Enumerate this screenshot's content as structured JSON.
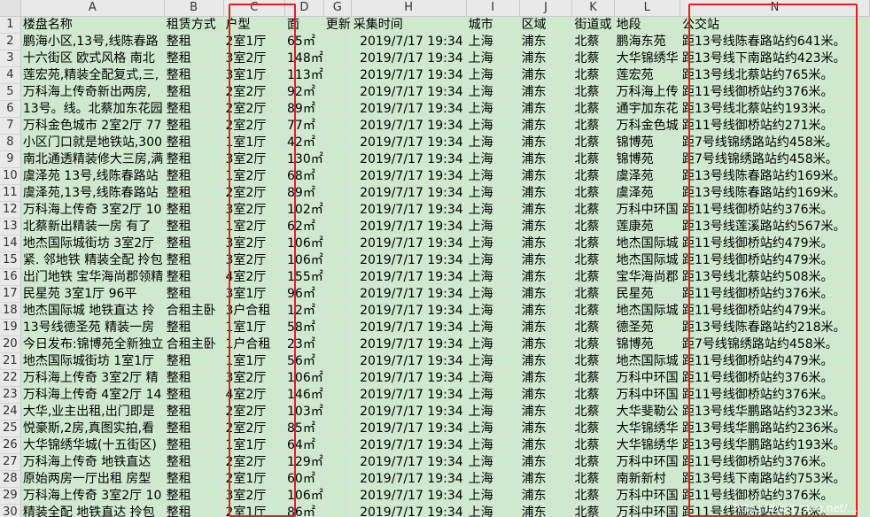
{
  "colhead": [
    "",
    "A",
    "B",
    "C",
    "D",
    "G",
    "H",
    "I",
    "J",
    "K",
    "L",
    "N"
  ],
  "rownums": [
    "1",
    "2",
    "3",
    "4",
    "5",
    "6",
    "7",
    "8",
    "9",
    "10",
    "11",
    "12",
    "13",
    "14",
    "15",
    "16",
    "17",
    "18",
    "19",
    "20",
    "21",
    "22",
    "23",
    "24",
    "25",
    "26",
    "27",
    "28",
    "29",
    "30"
  ],
  "header": [
    "楼盘名称",
    "租赁方式",
    "户型",
    "面",
    "更新",
    "采集时间",
    "城市",
    "区域",
    "街道或",
    "地段",
    "公交站"
  ],
  "rows": [
    [
      "鹏海小区,13号,线陈春路",
      "整租",
      "2室1厅",
      "65㎡",
      "",
      "2019/7/17 19:34",
      "上海",
      "浦东",
      "北蔡",
      "鹏海东苑",
      "距13号线陈春路站约641米。"
    ],
    [
      "十六街区 欧式风格 南北",
      "整租",
      "3室2厅",
      "148㎡",
      "",
      "2019/7/17 19:34",
      "上海",
      "浦东",
      "北蔡",
      "大华锦绣华",
      "距13号线下南路站约423米。"
    ],
    [
      "莲宏苑,精装全配复式,三,",
      "整租",
      "3室1厅",
      "113㎡",
      "",
      "2019/7/17 19:34",
      "上海",
      "浦东",
      "北蔡",
      "莲宏苑",
      "距13号线北蔡站约765米。"
    ],
    [
      "万科海上传奇新出两房,",
      "整租",
      "2室2厅",
      "92㎡",
      "",
      "2019/7/17 19:34",
      "上海",
      "浦东",
      "北蔡",
      "万科海上传",
      "距11号线御桥站约376米。"
    ],
    [
      "13号。线。北蔡加东花园",
      "整租",
      "2室2厅",
      "89㎡",
      "",
      "2019/7/17 19:34",
      "上海",
      "浦东",
      "北蔡",
      "通宇加东花",
      "距13号线北蔡站约193米。"
    ],
    [
      "万科金色城市 2室2厅 77",
      "整租",
      "2室2厅",
      "77㎡",
      "",
      "2019/7/17 19:34",
      "上海",
      "浦东",
      "北蔡",
      "万科金色城",
      "距11号线御桥站约271米。"
    ],
    [
      "小区门口就是地铁站,300",
      "整租",
      "1室1厅",
      "42㎡",
      "",
      "2019/7/17 19:34",
      "上海",
      "浦东",
      "北蔡",
      "锦博苑",
      "距7号线锦绣路站约458米。"
    ],
    [
      "南北通透精装修大三房,满",
      "整租",
      "3室2厅",
      "130㎡",
      "",
      "2019/7/17 19:34",
      "上海",
      "浦东",
      "北蔡",
      "锦博苑",
      "距7号线锦绣路站约458米。"
    ],
    [
      "虞泽苑 13号,线陈春路站",
      "整租",
      "1室2厅",
      "68㎡",
      "",
      "2019/7/17 19:34",
      "上海",
      "浦东",
      "北蔡",
      "虞泽苑",
      "距13号线陈春路站约169米。"
    ],
    [
      "虞泽苑,13号,线陈春路站",
      "整租",
      "2室2厅",
      "89㎡",
      "",
      "2019/7/17 19:34",
      "上海",
      "浦东",
      "北蔡",
      "虞泽苑",
      "距13号线陈春路站约169米。"
    ],
    [
      "万科海上传奇 3室2厅 10",
      "整租",
      "3室2厅",
      "102㎡",
      "",
      "2019/7/17 19:34",
      "上海",
      "浦东",
      "北蔡",
      "万科中环国",
      "距11号线御桥站约376米。"
    ],
    [
      "北蔡新出精装一房 有了",
      "整租",
      "1室2厅",
      "62㎡",
      "",
      "2019/7/17 19:34",
      "上海",
      "浦东",
      "北蔡",
      "莲康苑",
      "距13号线莲溪路站约567米。"
    ],
    [
      "地杰国际城街坊 3室2厅",
      "整租",
      "3室2厅",
      "106㎡",
      "",
      "2019/7/17 19:34",
      "上海",
      "浦东",
      "北蔡",
      "地杰国际城",
      "距11号线御桥站约479米。"
    ],
    [
      "紧. 邻地铁 精装全配 拎包",
      "整租",
      "3室2厅",
      "106㎡",
      "",
      "2019/7/17 19:34",
      "上海",
      "浦东",
      "北蔡",
      "地杰国际城",
      "距11号线御桥站约479米。"
    ],
    [
      "出门地铁 宝华海尚郡领精",
      "整租",
      "4室2厅",
      "155㎡",
      "",
      "2019/7/17 19:34",
      "上海",
      "浦东",
      "北蔡",
      "宝华海尚郡",
      "距13号线北蔡站约508米。"
    ],
    [
      "民星苑 3室1厅 96平",
      "整租",
      "3室1厅",
      "96㎡",
      "",
      "2019/7/17 19:34",
      "上海",
      "浦东",
      "北蔡",
      "民星苑",
      "距11号线御桥站约376米。"
    ],
    [
      "地杰国际城 地铁直达 拎",
      "合租主卧",
      "3户合租",
      "12㎡",
      "",
      "2019/7/17 19:34",
      "上海",
      "浦东",
      "北蔡",
      "地杰国际城",
      "距11号线御桥站约479米。"
    ],
    [
      "13号线德圣苑 精装一房",
      "整租",
      "1室1厅",
      "58㎡",
      "",
      "2019/7/17 19:34",
      "上海",
      "浦东",
      "北蔡",
      "德圣苑",
      "距13号线陈春路站约218米。"
    ],
    [
      "今日发布:锦博苑全新独立",
      "合租主卧",
      "1户合租",
      "23㎡",
      "",
      "2019/7/17 19:34",
      "上海",
      "浦东",
      "北蔡",
      "锦博苑",
      "距7号线锦绣路站约458米。"
    ],
    [
      "地杰国际城街坊 1室1厅",
      "整租",
      "1室1厅",
      "56㎡",
      "",
      "2019/7/17 19:34",
      "上海",
      "浦东",
      "北蔡",
      "地杰国际城",
      "距11号线御桥站约479米。"
    ],
    [
      "万科海上传奇 3室2厅 精",
      "整租",
      "3室2厅",
      "106㎡",
      "",
      "2019/7/17 19:34",
      "上海",
      "浦东",
      "北蔡",
      "万科中环国",
      "距11号线御桥站约376米。"
    ],
    [
      "万科海上传奇 4室2厅 14",
      "整租",
      "4室2厅",
      "146㎡",
      "",
      "2019/7/17 19:34",
      "上海",
      "浦东",
      "北蔡",
      "万科中环国",
      "距11号线御桥站约376米。"
    ],
    [
      "大华,业主出租,出门即是",
      "整租",
      "2室2厅",
      "103㎡",
      "",
      "2019/7/17 19:34",
      "上海",
      "浦东",
      "北蔡",
      "大华斐勒公",
      "距13号线华鹏路站约323米。"
    ],
    [
      "悦豪斯,2房,真图实拍,看",
      "整租",
      "2室2厅",
      "85㎡",
      "",
      "2019/7/17 19:34",
      "上海",
      "浦东",
      "北蔡",
      "大华锦绣华",
      "距13号线华鹏路站约236米。"
    ],
    [
      "大华锦绣华城(十五街区)",
      "整租",
      "1室1厅",
      "64㎡",
      "",
      "2019/7/17 19:34",
      "上海",
      "浦东",
      "北蔡",
      "大华锦绣华",
      "距13号线华鹏路站约193米。"
    ],
    [
      "万科海上传奇 地铁直达",
      "整租",
      "2室2厅",
      "129㎡",
      "",
      "2019/7/17 19:34",
      "上海",
      "浦东",
      "北蔡",
      "万科中环国",
      "距11号线御桥站约376米。"
    ],
    [
      "原始两房一厅出租 房型",
      "整租",
      "2室1厅",
      "60㎡",
      "",
      "2019/7/17 19:34",
      "上海",
      "浦东",
      "北蔡",
      "南新新村",
      "距13号线下南路站约753米。"
    ],
    [
      "万科海上传奇 3室2厅 10",
      "整租",
      "3室2厅",
      "106㎡",
      "",
      "2019/7/17 19:34",
      "上海",
      "浦东",
      "北蔡",
      "万科中环国",
      "距11号线御桥站约376米。"
    ],
    [
      "精装全配 地铁直达 拎包",
      "整租",
      "2室1厅",
      "86㎡",
      "",
      "2019/7/17 19:34",
      "上海",
      "浦东",
      "北蔡",
      "万科中环国",
      "距11号线御桥站约376米。"
    ]
  ],
  "watermark": "https://blog.csdn.net/...",
  "colors": {
    "cell": "#cfe9cf",
    "header": "#e9e9e9",
    "highlight": "#e02020"
  }
}
